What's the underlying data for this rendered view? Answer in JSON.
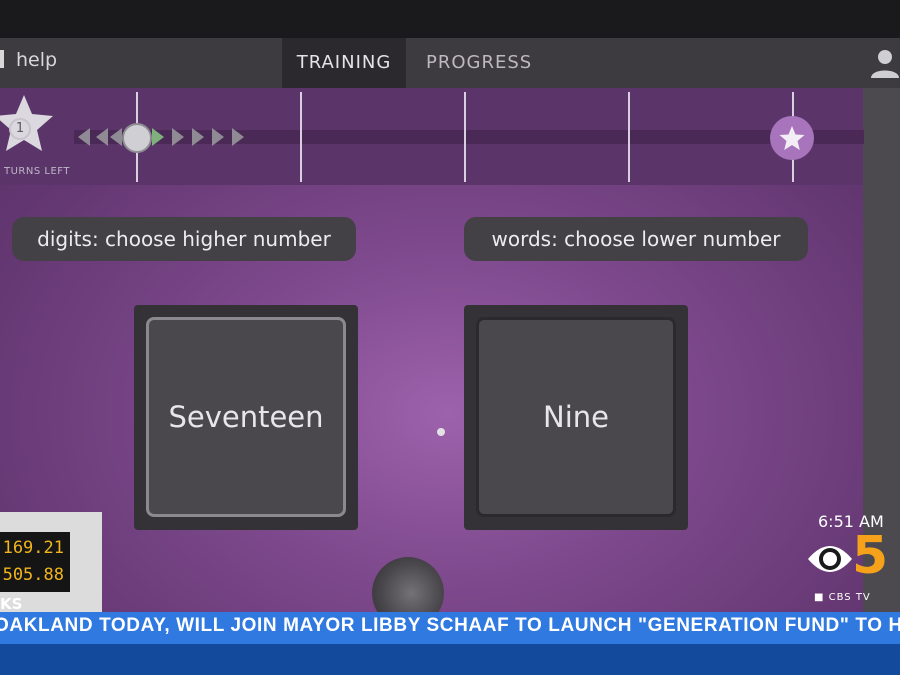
{
  "header": {
    "help_label": "help",
    "tabs": [
      {
        "label": "TRAINING",
        "active": true
      },
      {
        "label": "PROGRESS",
        "active": false
      }
    ]
  },
  "progress": {
    "turns_value": "1",
    "turns_label": "TURNS LEFT",
    "track_fill": 0.08
  },
  "task": {
    "left_prompt": "digits: choose higher number",
    "right_prompt": "words: choose lower number",
    "left_card": "Seventeen",
    "right_card": "Nine"
  },
  "broadcast": {
    "ticker_values": [
      "169.21",
      "505.88"
    ],
    "ticker_label": "KS",
    "time": "6:51 AM",
    "channel_number": "5",
    "channel_sub": "■ CBS TV",
    "crawl": "OAKLAND TODAY, WILL JOIN MAYOR LIBBY SCHAAF TO LAUNCH \"GENERATION FUND\" TO HELP"
  },
  "colors": {
    "stage": "#7f4a8e",
    "crawl": "#2f79e0",
    "accent": "#f5a11a"
  }
}
